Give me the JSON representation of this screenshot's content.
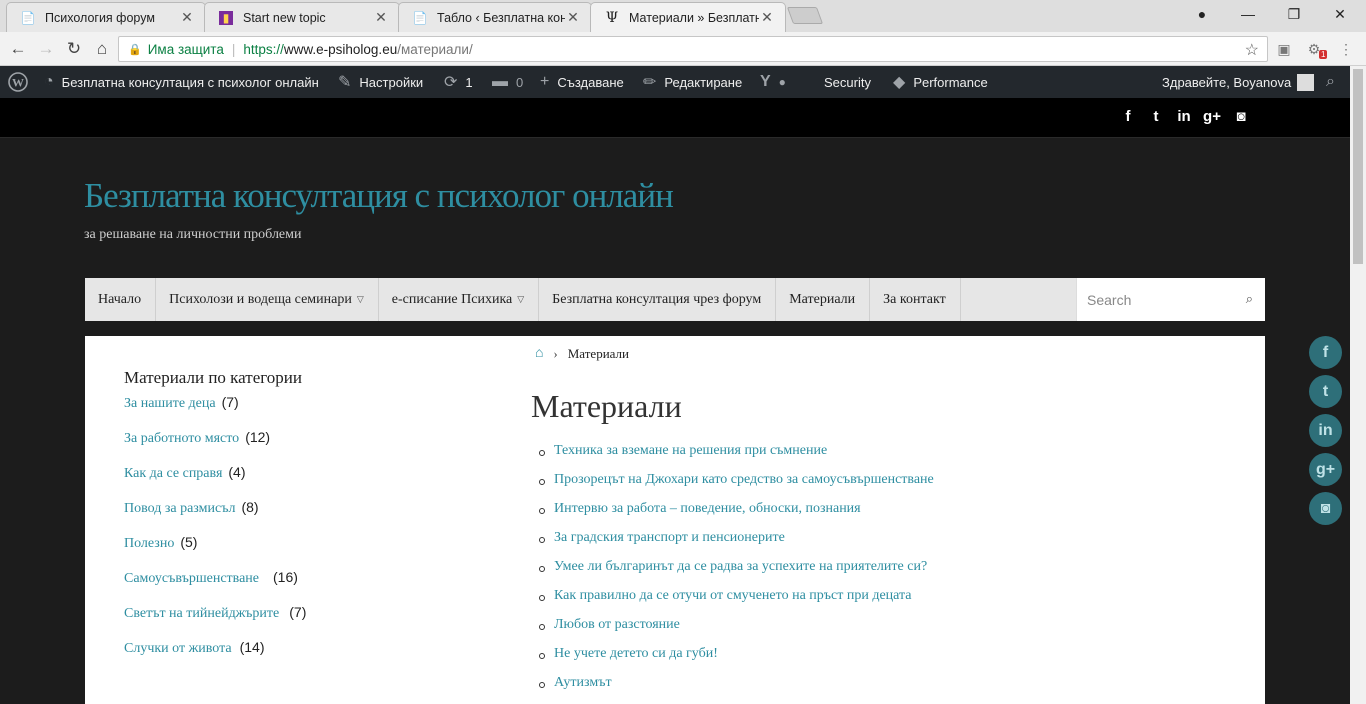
{
  "browser": {
    "tabs": [
      {
        "title": "Психология форум",
        "fav": "📄"
      },
      {
        "title": "Start new topic",
        "fav": "▮"
      },
      {
        "title": "Табло ‹ Безплатна конс",
        "fav": "📄"
      },
      {
        "title": "Материали » Безплатна",
        "fav": "Ψ"
      }
    ],
    "close_glyph": "✕",
    "url": {
      "secure_label": "Има защита",
      "protocol": "https://",
      "host": "www.e-psiholog.eu",
      "path": "/материали/"
    },
    "ext_badge": "1"
  },
  "adminbar": {
    "site_name": "Безплатна консултация с психолог онлайн",
    "customize": "Настройки",
    "updates": "1",
    "comments": "0",
    "new": "Създаване",
    "edit": "Редактиране",
    "security": "Security",
    "performance": "Performance",
    "greeting": "Здравейте, Boyanova"
  },
  "site": {
    "title": "Безплатна консултация с психолог онлайн",
    "description": "за решаване на личностни проблеми"
  },
  "nav": {
    "items": [
      "Начало",
      "Психолози и водеща семинари",
      "е-списание Психика",
      "Безплатна консултация чрез форум",
      "Материали",
      "За контакт"
    ],
    "search_placeholder": "Search"
  },
  "sidebar": {
    "title": "Материали по категории",
    "categories": [
      {
        "name": "За нашите деца",
        "count": "(7)"
      },
      {
        "name": "За работното място",
        "count": "(12)"
      },
      {
        "name": "Как да се справя",
        "count": "(4)"
      },
      {
        "name": "Повод за размисъл",
        "count": "(8)"
      },
      {
        "name": "Полезно",
        "count": "(5)"
      },
      {
        "name": "Самоусъвършенстване",
        "count": "(16)"
      },
      {
        "name": "Светът на тийнейджърите",
        "count": "(7)"
      },
      {
        "name": "Случки от живота",
        "count": "(14)"
      }
    ]
  },
  "main": {
    "breadcrumb_current": "Материали",
    "title": "Материали",
    "posts": [
      "Техника за вземане на решения при съмнение",
      "Прозорецът на Джохари като средство за самоусъвършенстване",
      "Интервю за работа – поведение, обноски, познания",
      "За градския транспорт и пенсионерите",
      "Умее ли българинът да се радва за успехите на приятелите си?",
      "Как правилно да се отучи от смученето на пръст при децата",
      "Любов от разстояние",
      "Не учете детето си да губи!",
      "Аутизмът"
    ]
  },
  "social": {
    "facebook": "f",
    "twitter": "t",
    "linkedin": "in",
    "googleplus": "g+",
    "instagram": "◙"
  },
  "colors": {
    "accent": "#2e8ea1",
    "adminbar": "#23282d",
    "floating_social": "#2e6f79"
  }
}
